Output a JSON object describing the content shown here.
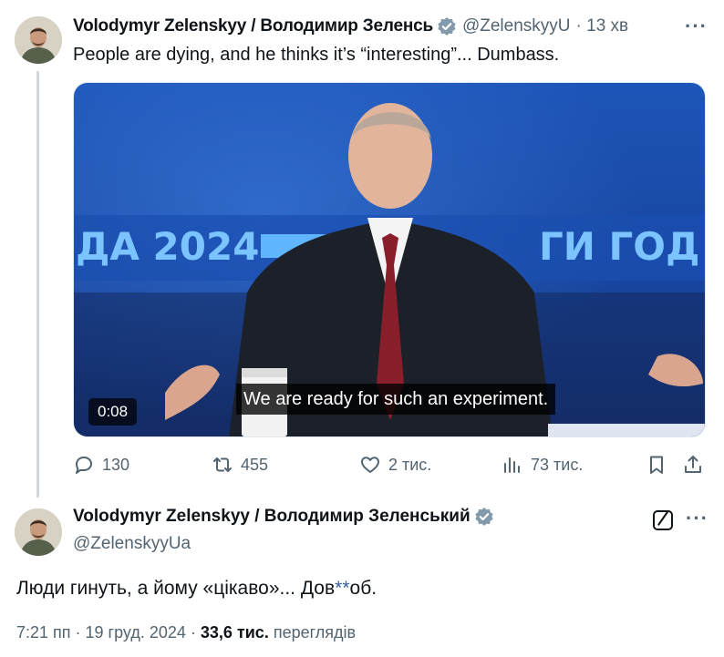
{
  "parent_tweet": {
    "author_name": "Volodymyr Zelenskyy / Володимир Зеленсь",
    "handle": "@ZelenskyyU",
    "time": "· 13 хв",
    "text": "People are dying, and he thinks it’s “interesting”... Dumbass.",
    "video": {
      "duration": "0:08",
      "subtitle": "We are ready for such an experiment.",
      "banner_left": "ДА 2024",
      "banner_right": "ГИ ГОД"
    },
    "actions": {
      "replies": "130",
      "reposts": "455",
      "likes": "2 тис.",
      "views": "73 тис."
    }
  },
  "main_tweet": {
    "author_name": "Volodymyr Zelenskyy / Володимир Зеленський",
    "handle": "@ZelenskyyUa",
    "text_before": "Люди гинуть, а йому «цікаво»... Дов",
    "text_stars": "**",
    "text_after": "об.",
    "timestamp": "7:21 пп · 19 груд. 2024 ·",
    "view_count": "33,6 тис.",
    "views_label": "переглядів"
  },
  "icons": {
    "verified": "verified-badge-icon",
    "reply": "reply-icon",
    "repost": "repost-icon",
    "like": "heart-icon",
    "views": "views-icon",
    "bookmark": "bookmark-icon",
    "share": "share-icon",
    "grok": "grok-icon",
    "more": "more-icon"
  },
  "colors": {
    "verified_badge": "#829aab",
    "secondary_text": "#536471",
    "video_backdrop": "#1a4aa8"
  }
}
